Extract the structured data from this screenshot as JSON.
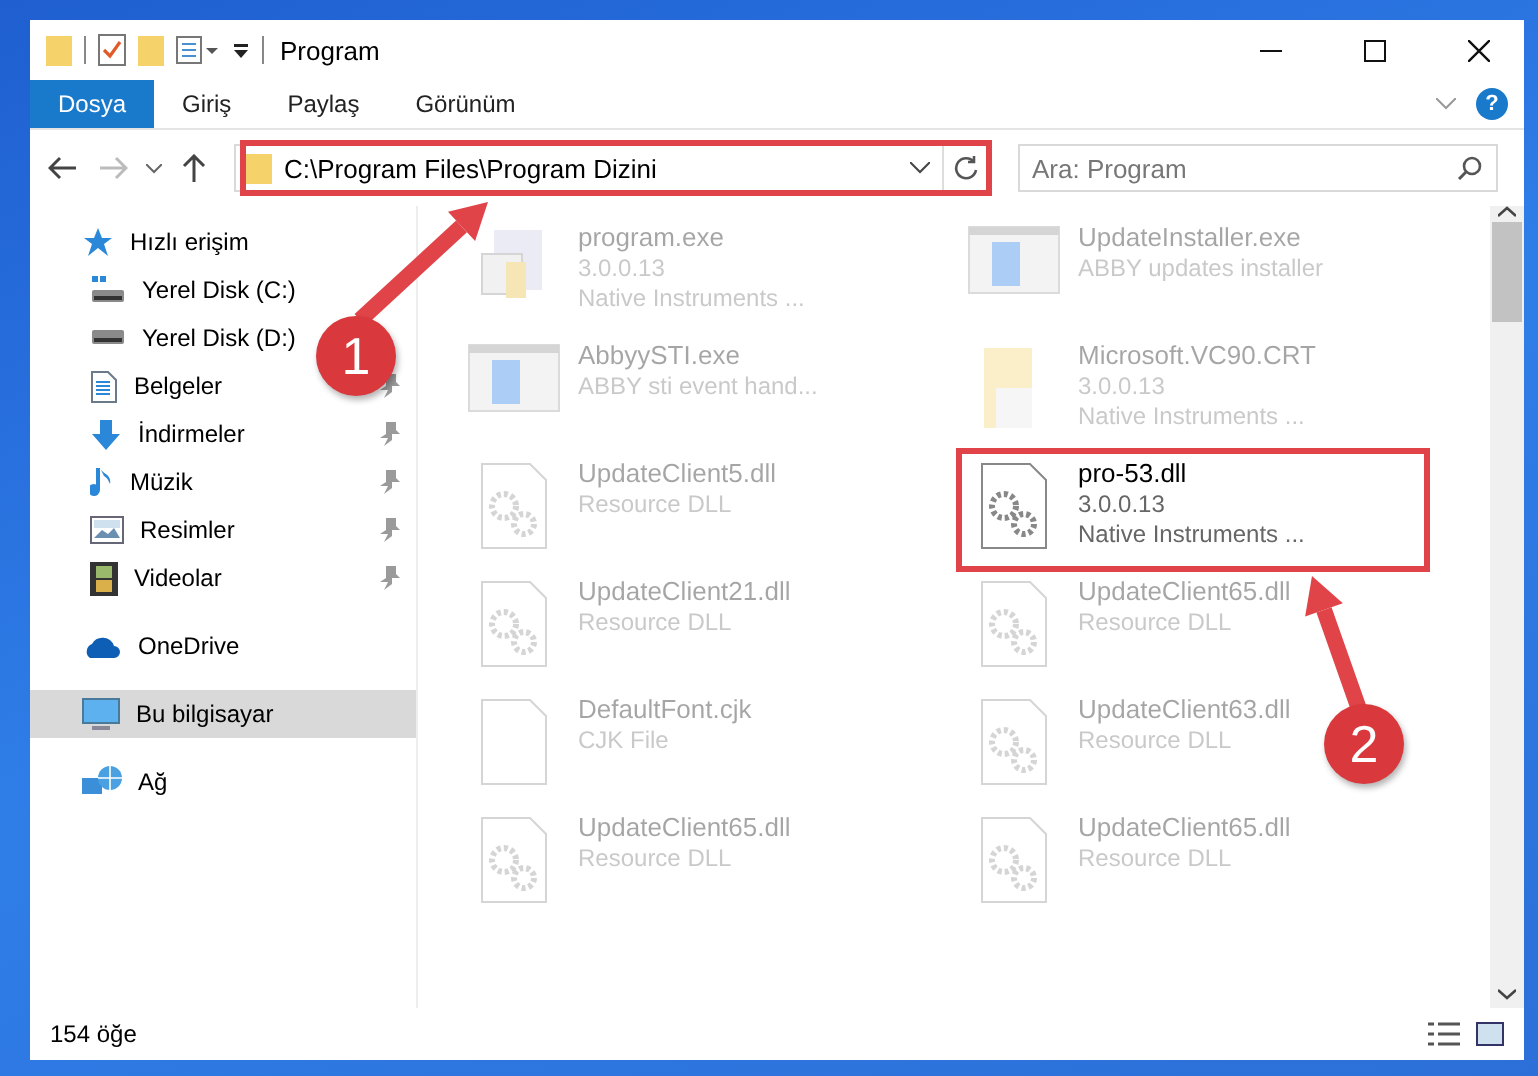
{
  "window": {
    "title": "Program"
  },
  "ribbon": {
    "tabs": [
      {
        "label": "Dosya",
        "selected": true
      },
      {
        "label": "Giriş",
        "selected": false
      },
      {
        "label": "Paylaş",
        "selected": false
      },
      {
        "label": "Görünüm",
        "selected": false
      }
    ],
    "help_button": "?"
  },
  "address_bar": {
    "path": "C:\\Program Files\\Program Dizini"
  },
  "search": {
    "placeholder": "Ara: Program"
  },
  "sidebar": {
    "items": [
      {
        "label": "Hızlı erişim",
        "kind": "star",
        "selected": false,
        "children": [
          {
            "label": "Yerel Disk (C:)",
            "kind": "drive-c",
            "pinned": false
          },
          {
            "label": "Yerel Disk (D:)",
            "kind": "drive",
            "pinned": false
          },
          {
            "label": "Belgeler",
            "kind": "docs",
            "pinned": true
          },
          {
            "label": "İndirmeler",
            "kind": "download",
            "pinned": true
          },
          {
            "label": "Müzik",
            "kind": "music",
            "pinned": true
          },
          {
            "label": "Resimler",
            "kind": "pictures",
            "pinned": true
          },
          {
            "label": "Videolar",
            "kind": "videos",
            "pinned": true
          }
        ]
      },
      {
        "label": "OneDrive",
        "kind": "cloud",
        "selected": false
      },
      {
        "label": "Bu bilgisayar",
        "kind": "computer",
        "selected": true
      },
      {
        "label": "Ağ",
        "kind": "network",
        "selected": false
      }
    ]
  },
  "files": [
    {
      "name": "program.exe",
      "details": [
        "3.0.0.13",
        "Native Instruments ..."
      ],
      "kind": "app",
      "faded": true,
      "highlighted": false
    },
    {
      "name": "UpdateInstaller.exe",
      "details": [
        "ABBY updates installer"
      ],
      "kind": "window",
      "faded": true,
      "highlighted": false
    },
    {
      "name": "AbbyySTI.exe",
      "details": [
        "ABBY sti event hand..."
      ],
      "kind": "window",
      "faded": true,
      "highlighted": false
    },
    {
      "name": "Microsoft.VC90.CRT",
      "details": [
        "3.0.0.13",
        "Native Instruments ..."
      ],
      "kind": "folder",
      "faded": true,
      "highlighted": false
    },
    {
      "name": "UpdateClient5.dll",
      "details": [
        "Resource DLL"
      ],
      "kind": "dll",
      "faded": true,
      "highlighted": false
    },
    {
      "name": "pro-53.dll",
      "details": [
        "3.0.0.13",
        "Native Instruments ..."
      ],
      "kind": "dll",
      "faded": false,
      "highlighted": true
    },
    {
      "name": "UpdateClient21.dll",
      "details": [
        "Resource DLL"
      ],
      "kind": "dll",
      "faded": true,
      "highlighted": false
    },
    {
      "name": "UpdateClient65.dll",
      "details": [
        "Resource DLL"
      ],
      "kind": "dll",
      "faded": true,
      "highlighted": false
    },
    {
      "name": "DefaultFont.cjk",
      "details": [
        "CJK File"
      ],
      "kind": "file",
      "faded": true,
      "highlighted": false
    },
    {
      "name": "UpdateClient63.dll",
      "details": [
        "Resource DLL"
      ],
      "kind": "dll",
      "faded": true,
      "highlighted": false
    },
    {
      "name": "UpdateClient65.dll",
      "details": [
        "Resource DLL"
      ],
      "kind": "dll",
      "faded": true,
      "highlighted": false
    },
    {
      "name": "UpdateClient65.dll",
      "details": [
        "Resource DLL"
      ],
      "kind": "dll",
      "faded": true,
      "highlighted": false
    }
  ],
  "status_bar": {
    "item_count": "154 öğe"
  },
  "annotations": [
    {
      "number": "1"
    },
    {
      "number": "2"
    }
  ]
}
